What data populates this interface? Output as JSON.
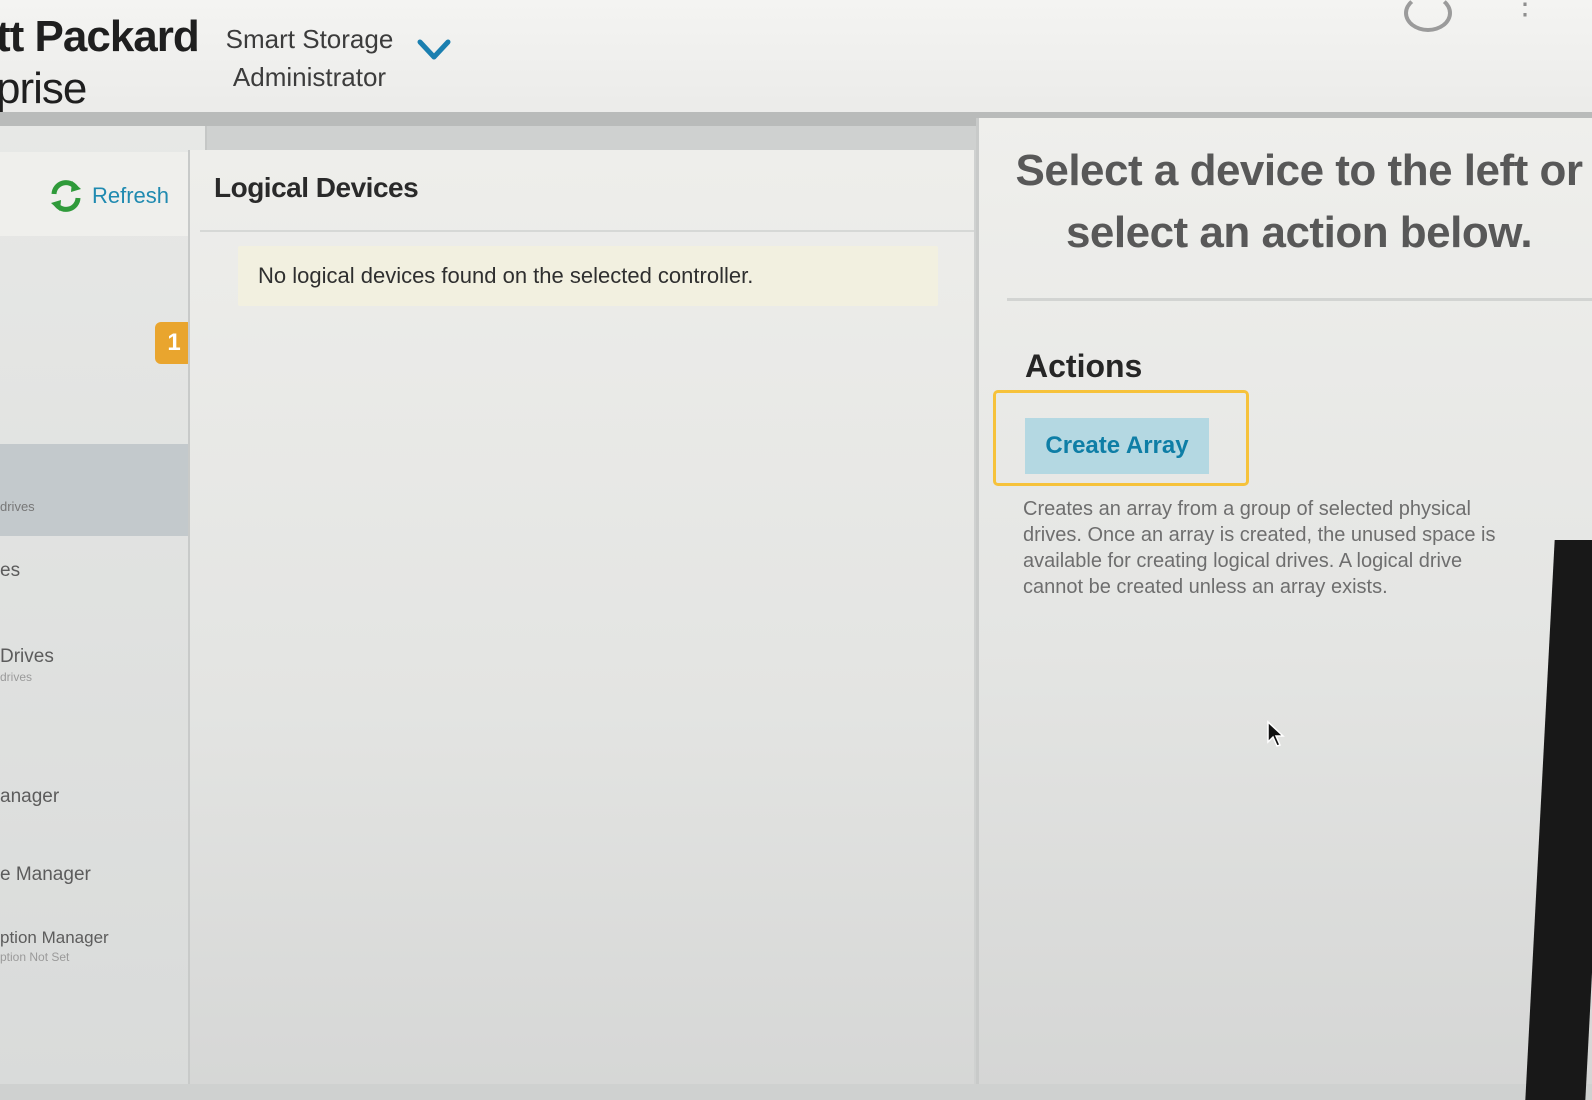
{
  "header": {
    "brand_line1": "tt Packard",
    "brand_line2": "prise",
    "app_name": "Smart Storage Administrator",
    "dropdown_icon": "chevron-down-icon",
    "accent_color": "#1a7fb0"
  },
  "left_nav": {
    "refresh_label": "Refresh",
    "refresh_icon": "refresh-icon",
    "badge_count": "1",
    "items": [
      {
        "label": "drives",
        "sub": ""
      },
      {
        "label": "es",
        "sub": ""
      },
      {
        "label": "Drives",
        "sub": "drives"
      },
      {
        "label": "anager",
        "sub": ""
      },
      {
        "label": "e Manager",
        "sub": ""
      },
      {
        "label": "ption Manager",
        "sub": "ption Not Set"
      }
    ]
  },
  "main": {
    "title": "Logical Devices",
    "empty_message": "No logical devices found on the selected controller."
  },
  "right": {
    "prompt_line1": "Select a device to the left or",
    "prompt_line2": "select an action below.",
    "actions_heading": "Actions",
    "create_array_label": "Create Array",
    "create_array_description": "Creates an array from a group of selected physical drives. Once an array is created, the unused space is available for creating logical drives. A logical drive cannot be created unless an array exists.",
    "highlight_color": "#f6c23b",
    "button_color": "#b4d8e2"
  }
}
